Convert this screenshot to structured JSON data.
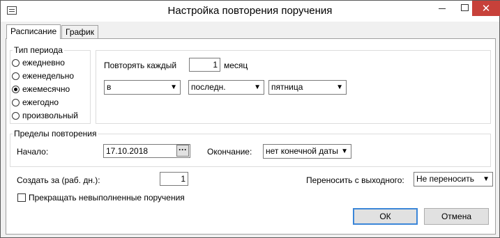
{
  "window": {
    "title": "Настройка повторения поручения",
    "close_symbol": "✕"
  },
  "tabs": [
    {
      "label": "Расписание",
      "active": true
    },
    {
      "label": "График",
      "active": false
    }
  ],
  "period": {
    "legend": "Тип периода",
    "options": [
      {
        "label": "ежедневно",
        "selected": false
      },
      {
        "label": "еженедельно",
        "selected": false
      },
      {
        "label": "ежемесячно",
        "selected": true
      },
      {
        "label": "ежегодно",
        "selected": false
      },
      {
        "label": "произвольный",
        "selected": false
      }
    ]
  },
  "schedule": {
    "repeat_label": "Повторять каждый",
    "repeat_value": "1",
    "unit_label": "месяц",
    "combo_in": "в",
    "combo_which": "последн.",
    "combo_day": "пятница"
  },
  "limits": {
    "legend": "Пределы повторения",
    "start_label": "Начало:",
    "start_value": "17.10.2018",
    "end_label": "Окончание:",
    "end_value": "нет конечной даты"
  },
  "create": {
    "label": "Создать за (раб. дн.):",
    "value": "1"
  },
  "transfer": {
    "label": "Переносить с выходного:",
    "value": "Не переносить"
  },
  "stop_checkbox": {
    "label": "Прекращать невыполненные поручения",
    "checked": false
  },
  "buttons": {
    "ok": "ОК",
    "cancel": "Отмена"
  }
}
